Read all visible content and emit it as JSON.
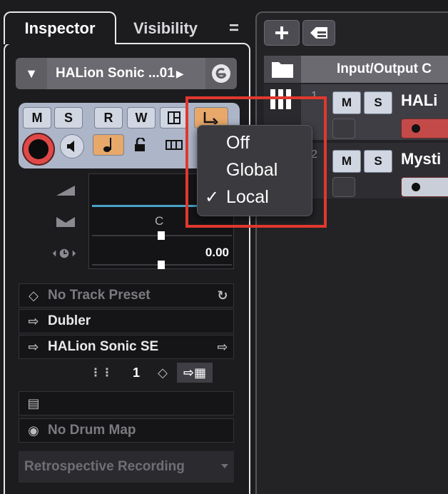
{
  "inspector": {
    "tabs": {
      "inspector": "Inspector",
      "visibility": "Visibility",
      "menu": "="
    },
    "preset_name": "HALion Sonic ...01",
    "buttons": {
      "mute": "M",
      "solo": "S",
      "read": "R",
      "write": "W"
    },
    "pan_label": "C",
    "volume_value": "0.00",
    "routing": {
      "track_preset": "No Track Preset",
      "input": "Dubler",
      "output": "HALion Sonic SE",
      "channel": "1"
    },
    "drum_map": "No Drum Map",
    "retrospective": "Retrospective Recording"
  },
  "popup": {
    "items": [
      "Off",
      "Global",
      "Local"
    ],
    "check": "✓"
  },
  "project": {
    "header": "Input/Output C",
    "tracks": [
      {
        "number": "1",
        "name": "HALi",
        "mute": "M",
        "solo": "S"
      },
      {
        "number": "2",
        "name": "Mysti",
        "mute": "M",
        "solo": "S"
      }
    ]
  },
  "colors": {
    "highlight": "#e0382e",
    "accent_orange": "#e8a86a",
    "record_red": "#e04848",
    "fader_blue": "#48a4c8"
  }
}
